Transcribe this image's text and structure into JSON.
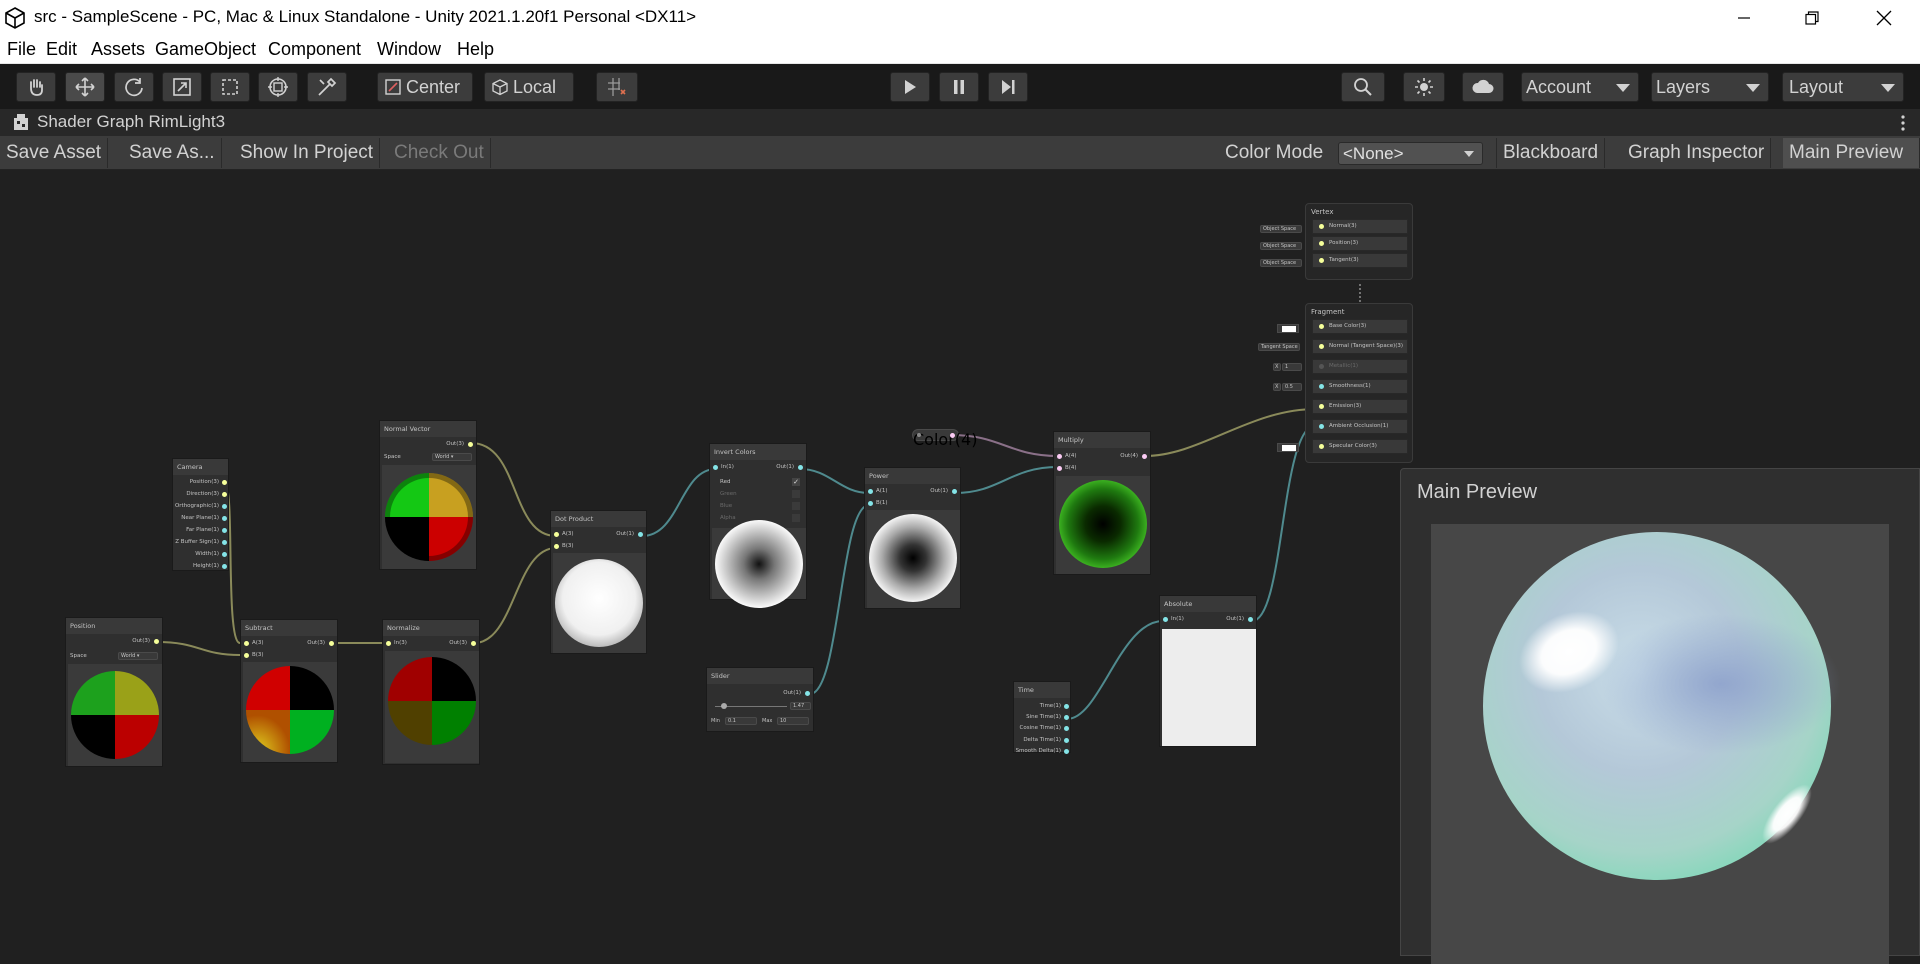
{
  "window": {
    "title": "src - SampleScene - PC, Mac & Linux Standalone - Unity 2021.1.20f1 Personal <DX11>"
  },
  "menu": [
    "File",
    "Edit",
    "Assets",
    "GameObject",
    "Component",
    "Window",
    "Help"
  ],
  "toolbar": {
    "pivot_label": "Center",
    "space_label": "Local",
    "account_label": "Account",
    "layers_label": "Layers",
    "layout_label": "Layout"
  },
  "tab": {
    "title": "Shader Graph RimLight3"
  },
  "graph_toolbar": {
    "save_asset": "Save Asset",
    "save_as": "Save As...",
    "show_in_project": "Show In Project",
    "check_out": "Check Out",
    "color_mode_label": "Color Mode",
    "color_mode_value": "<None>",
    "blackboard": "Blackboard",
    "graph_inspector": "Graph Inspector",
    "main_preview": "Main Preview"
  },
  "nodes": {
    "position": {
      "title": "Position",
      "out": "Out(3)",
      "space_label": "Space",
      "space_value": "World"
    },
    "camera": {
      "title": "Camera",
      "outputs": [
        "Position(3)",
        "Direction(3)",
        "Orthographic(1)",
        "Near Plane(1)",
        "Far Plane(1)",
        "Z Buffer Sign(1)",
        "Width(1)",
        "Height(1)"
      ]
    },
    "subtract": {
      "title": "Subtract",
      "in_a": "A(3)",
      "in_b": "B(3)",
      "out": "Out(3)"
    },
    "normal_vector": {
      "title": "Normal Vector",
      "out": "Out(3)",
      "space_label": "Space",
      "space_value": "World"
    },
    "normalize": {
      "title": "Normalize",
      "in": "In(3)",
      "out": "Out(3)"
    },
    "dot_product": {
      "title": "Dot Product",
      "in_a": "A(3)",
      "in_b": "B(3)",
      "out": "Out(1)"
    },
    "invert_colors": {
      "title": "Invert Colors",
      "in": "In(1)",
      "out": "Out(1)",
      "channels": [
        "Red",
        "Green",
        "Blue",
        "Alpha"
      ]
    },
    "slider": {
      "title": "Slider",
      "out": "Out(1)",
      "value": "1.47",
      "min_label": "Min",
      "min_value": "0.1",
      "max_label": "Max",
      "max_value": "10"
    },
    "power": {
      "title": "Power",
      "in_a": "A(1)",
      "in_b": "B(1)",
      "out": "Out(1)"
    },
    "color_property": {
      "title": "Color(4)"
    },
    "multiply": {
      "title": "Multiply",
      "in_a": "A(4)",
      "in_b": "B(4)",
      "out": "Out(4)"
    },
    "time": {
      "title": "Time",
      "outputs": [
        "Time(1)",
        "Sine Time(1)",
        "Cosine Time(1)",
        "Delta Time(1)",
        "Smooth Delta(1)"
      ]
    },
    "absolute": {
      "title": "Absolute",
      "in": "In(1)",
      "out": "Out(1)"
    }
  },
  "master": {
    "vertex_title": "Vertex",
    "vertex_slots": [
      "Normal(3)",
      "Position(3)",
      "Tangent(3)"
    ],
    "vertex_defaults": [
      "Object Space",
      "Object Space",
      "Object Space"
    ],
    "fragment_title": "Fragment",
    "fragment_slots": [
      "Base Color(3)",
      "Normal (Tangent Space)(3)",
      "Metallic(1)",
      "Smoothness(1)",
      "Emission(3)",
      "Ambient Occlusion(1)",
      "Specular Color(3)"
    ],
    "normal_default": "Tangent Space",
    "metallic_x": "X",
    "metallic_value": "1",
    "smoothness_x": "X",
    "smoothness_value": "0.5"
  },
  "main_preview_panel": {
    "title": "Main Preview"
  },
  "colors": {
    "accent_vector3": "#f6ff9a",
    "accent_vector1": "#84e4e7",
    "accent_vector4": "#fbcbf4",
    "wire_vector3": "#8a8a5a",
    "wire_vector1": "#4f8a8e",
    "wire_vector4": "#8a7088"
  }
}
